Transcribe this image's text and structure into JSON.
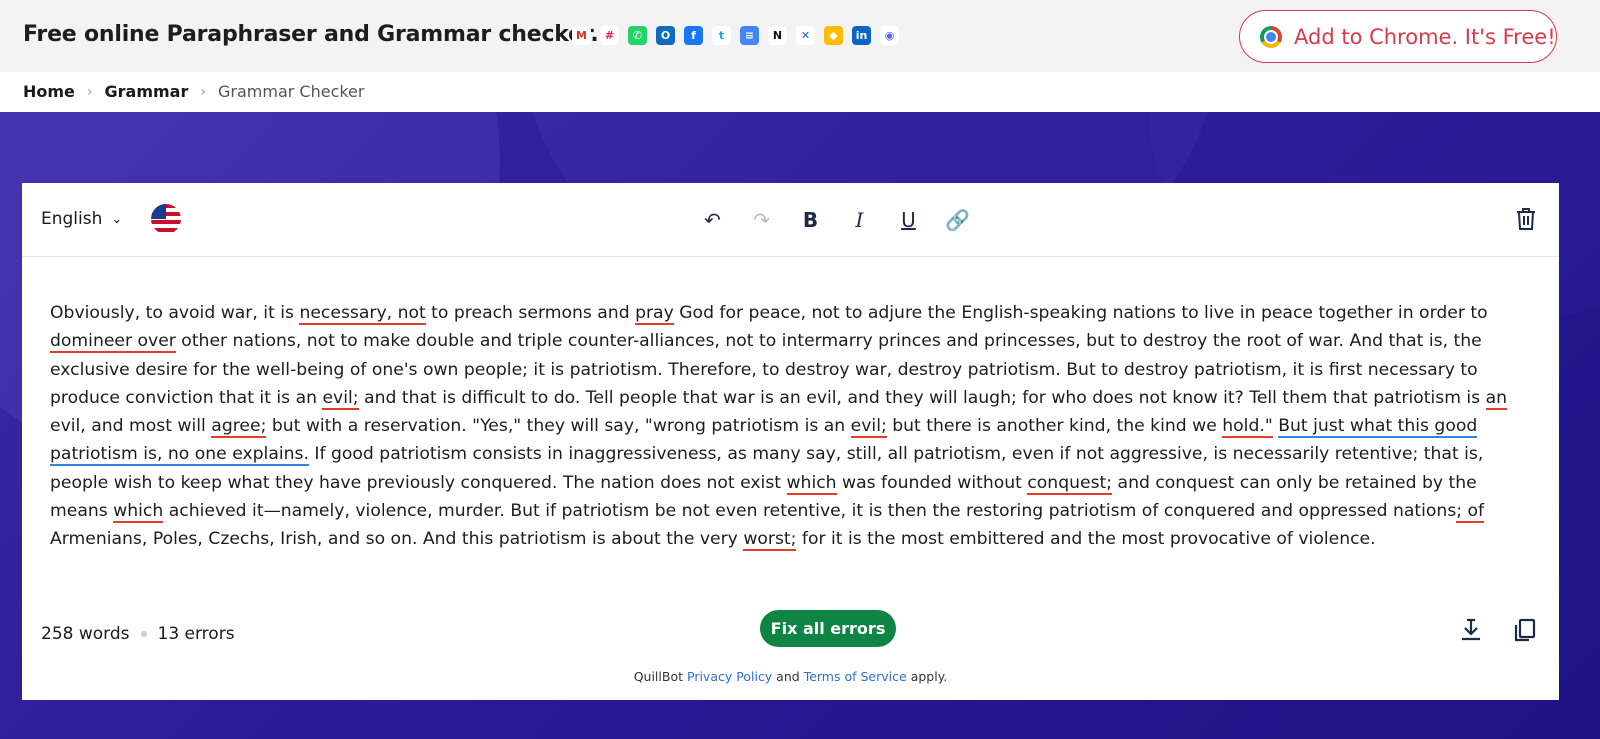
{
  "header": {
    "site_title": "Free online Paraphraser and Grammar checker.",
    "apps": [
      {
        "name": "gmail-icon",
        "glyph": "M",
        "color": "#ffffff",
        "fg": "#d93025"
      },
      {
        "name": "slack-icon",
        "glyph": "#",
        "color": "#ffffff",
        "fg": "#e01e5a"
      },
      {
        "name": "whatsapp-icon",
        "glyph": "✆",
        "color": "#25d366",
        "fg": "#ffffff"
      },
      {
        "name": "outlook-icon",
        "glyph": "O",
        "color": "#0f6cbd",
        "fg": "#ffffff"
      },
      {
        "name": "facebook-icon",
        "glyph": "f",
        "color": "#1877f2",
        "fg": "#ffffff"
      },
      {
        "name": "twitter-icon",
        "glyph": "t",
        "color": "#ffffff",
        "fg": "#1da1f2"
      },
      {
        "name": "google-docs-icon",
        "glyph": "≡",
        "color": "#4285f4",
        "fg": "#ffffff"
      },
      {
        "name": "notion-icon",
        "glyph": "N",
        "color": "#ffffff",
        "fg": "#111111"
      },
      {
        "name": "confluence-icon",
        "glyph": "✕",
        "color": "#ffffff",
        "fg": "#1868db"
      },
      {
        "name": "google-keep-icon",
        "glyph": "◆",
        "color": "#fbbc04",
        "fg": "#ffffff"
      },
      {
        "name": "linkedin-icon",
        "glyph": "in",
        "color": "#0a66c2",
        "fg": "#ffffff"
      },
      {
        "name": "discord-icon",
        "glyph": "◉",
        "color": "#ffffff",
        "fg": "#5865f2"
      }
    ],
    "chrome_button": "Add to Chrome. It's Free!"
  },
  "breadcrumb": {
    "home": "Home",
    "section": "Grammar",
    "current": "Grammar Checker"
  },
  "editor": {
    "language": "English",
    "tools": [
      {
        "name": "undo-icon",
        "glyph": "↶",
        "cls": ""
      },
      {
        "name": "redo-icon",
        "glyph": "↷",
        "cls": "disabled"
      },
      {
        "name": "bold-icon",
        "glyph": "B",
        "cls": "b"
      },
      {
        "name": "italic-icon",
        "glyph": "I",
        "cls": "i"
      },
      {
        "name": "underline-icon",
        "glyph": "U",
        "cls": "u"
      },
      {
        "name": "link-icon",
        "glyph": "🔗",
        "cls": ""
      }
    ],
    "segments": [
      {
        "t": "Obviously, to avoid war, it is ",
        "k": ""
      },
      {
        "t": "necessary, not",
        "k": "err"
      },
      {
        "t": " to preach sermons and ",
        "k": ""
      },
      {
        "t": "pray",
        "k": "err"
      },
      {
        "t": " God for peace, not to adjure the English-speaking nations to live in peace together in order to ",
        "k": ""
      },
      {
        "t": "domineer over",
        "k": "err"
      },
      {
        "t": " other nations, not to make double and triple counter-alliances, not to intermarry princes and princesses, but to destroy the root of war. And that is, the exclusive desire for the well-being of one's own people; it is patriotism. Therefore, to destroy war, destroy patriotism. But to destroy patriotism, it is first necessary to produce conviction that it is an ",
        "k": ""
      },
      {
        "t": "evil;",
        "k": "err"
      },
      {
        "t": " and that is difficult to do. Tell people that war is an evil, and they will laugh; for who does not know it? Tell them that patriotism is ",
        "k": ""
      },
      {
        "t": "an",
        "k": "err"
      },
      {
        "t": " evil, and most will ",
        "k": ""
      },
      {
        "t": "agree;",
        "k": "err"
      },
      {
        "t": " but with a reservation. \"Yes,\" they will say, \"wrong patriotism is an ",
        "k": ""
      },
      {
        "t": "evil;",
        "k": "err"
      },
      {
        "t": " but there is another kind, the kind we ",
        "k": ""
      },
      {
        "t": "hold.\"",
        "k": "err"
      },
      {
        "t": " ",
        "k": ""
      },
      {
        "t": "But just what this good patriotism is, no one explains.",
        "k": "sug"
      },
      {
        "t": " If good patriotism consists in inaggressiveness, as many say, still, all patriotism, even if not aggressive, is necessarily retentive; that is, people wish to keep what they have previously conquered. The nation does not exist ",
        "k": ""
      },
      {
        "t": "which",
        "k": "err"
      },
      {
        "t": " was founded without ",
        "k": ""
      },
      {
        "t": "conquest;",
        "k": "err"
      },
      {
        "t": " and conquest can only be retained by the means ",
        "k": ""
      },
      {
        "t": "which",
        "k": "err"
      },
      {
        "t": " achieved it—namely, violence, murder. But if patriotism be not even retentive, it is then the restoring patriotism of conquered and oppressed nations",
        "k": ""
      },
      {
        "t": "; of",
        "k": "err"
      },
      {
        "t": " Armenians, Poles, Czechs, Irish, and so on. And this patriotism is about the very ",
        "k": ""
      },
      {
        "t": "worst;",
        "k": "err"
      },
      {
        "t": " for it is the most embittered and the most provocative of violence.",
        "k": ""
      }
    ],
    "word_count": "258 words",
    "error_count": "13 errors",
    "fix_button": "Fix all errors",
    "footer": {
      "brand": "QuillBot",
      "privacy": "Privacy Policy",
      "and": "and",
      "terms": "Terms of Service",
      "apply": "apply."
    }
  },
  "colors": {
    "error_underline": "#e23d2c",
    "suggestion_underline": "#2d86e0",
    "fix_button": "#0e8545",
    "hero_bg": "#2b1b96",
    "chrome_accent": "#d93a4a"
  }
}
